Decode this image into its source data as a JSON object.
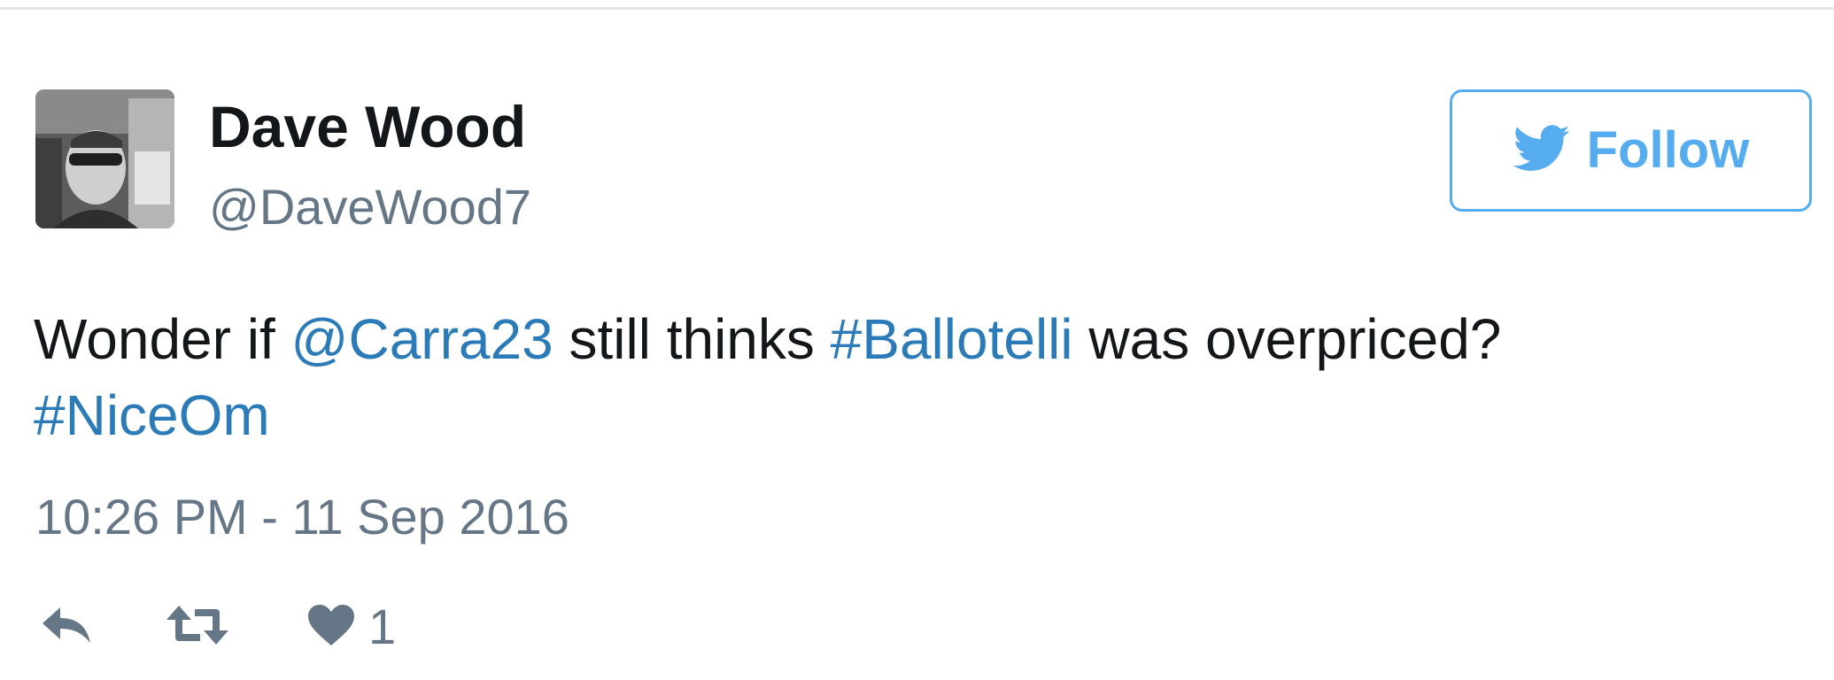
{
  "tweet": {
    "author": {
      "name": "Dave Wood",
      "handle": "@DaveWood7"
    },
    "follow_button": {
      "label": "Follow",
      "icon": "twitter-bird-icon"
    },
    "text": {
      "part1": "Wonder if ",
      "mention": "@Carra23",
      "part2": " still thinks ",
      "hashtag1": "#Ballotelli",
      "part3": " was overpriced?",
      "hashtag2": "#NiceOm"
    },
    "timestamp": "10:26 PM - 11 Sep 2016",
    "actions": {
      "reply_icon": "reply-icon",
      "retweet_icon": "retweet-icon",
      "like_icon": "heart-icon",
      "like_count": "1"
    }
  },
  "colors": {
    "text": "#14171a",
    "secondary": "#657786",
    "link": "#2b7bb9",
    "brand": "#55acee",
    "border": "#e1e8ed"
  }
}
